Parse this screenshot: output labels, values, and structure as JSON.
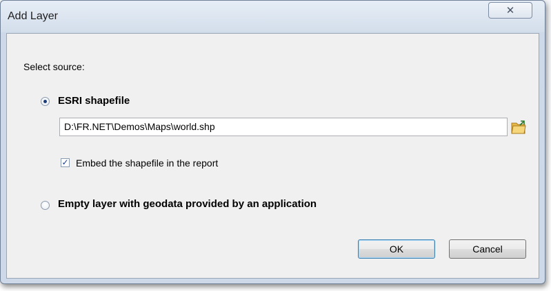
{
  "window": {
    "title": "Add Layer",
    "close_glyph": "✕"
  },
  "source": {
    "label": "Select source:",
    "options": [
      {
        "label": "ESRI shapefile",
        "selected": true
      },
      {
        "label": "Empty layer with geodata provided by an application",
        "selected": false
      }
    ],
    "shapefile_path": "D:\\FR.NET\\Demos\\Maps\\world.shp",
    "browse_icon": "open-folder-icon",
    "embed": {
      "label": "Embed the shapefile in the report",
      "checked": true
    }
  },
  "buttons": {
    "ok": "OK",
    "cancel": "Cancel"
  },
  "colors": {
    "frame": "#cdd9e8",
    "client": "#f0f0f0",
    "radio_dot": "#1a3d7a",
    "default_button_border": "#3c7fb1"
  }
}
